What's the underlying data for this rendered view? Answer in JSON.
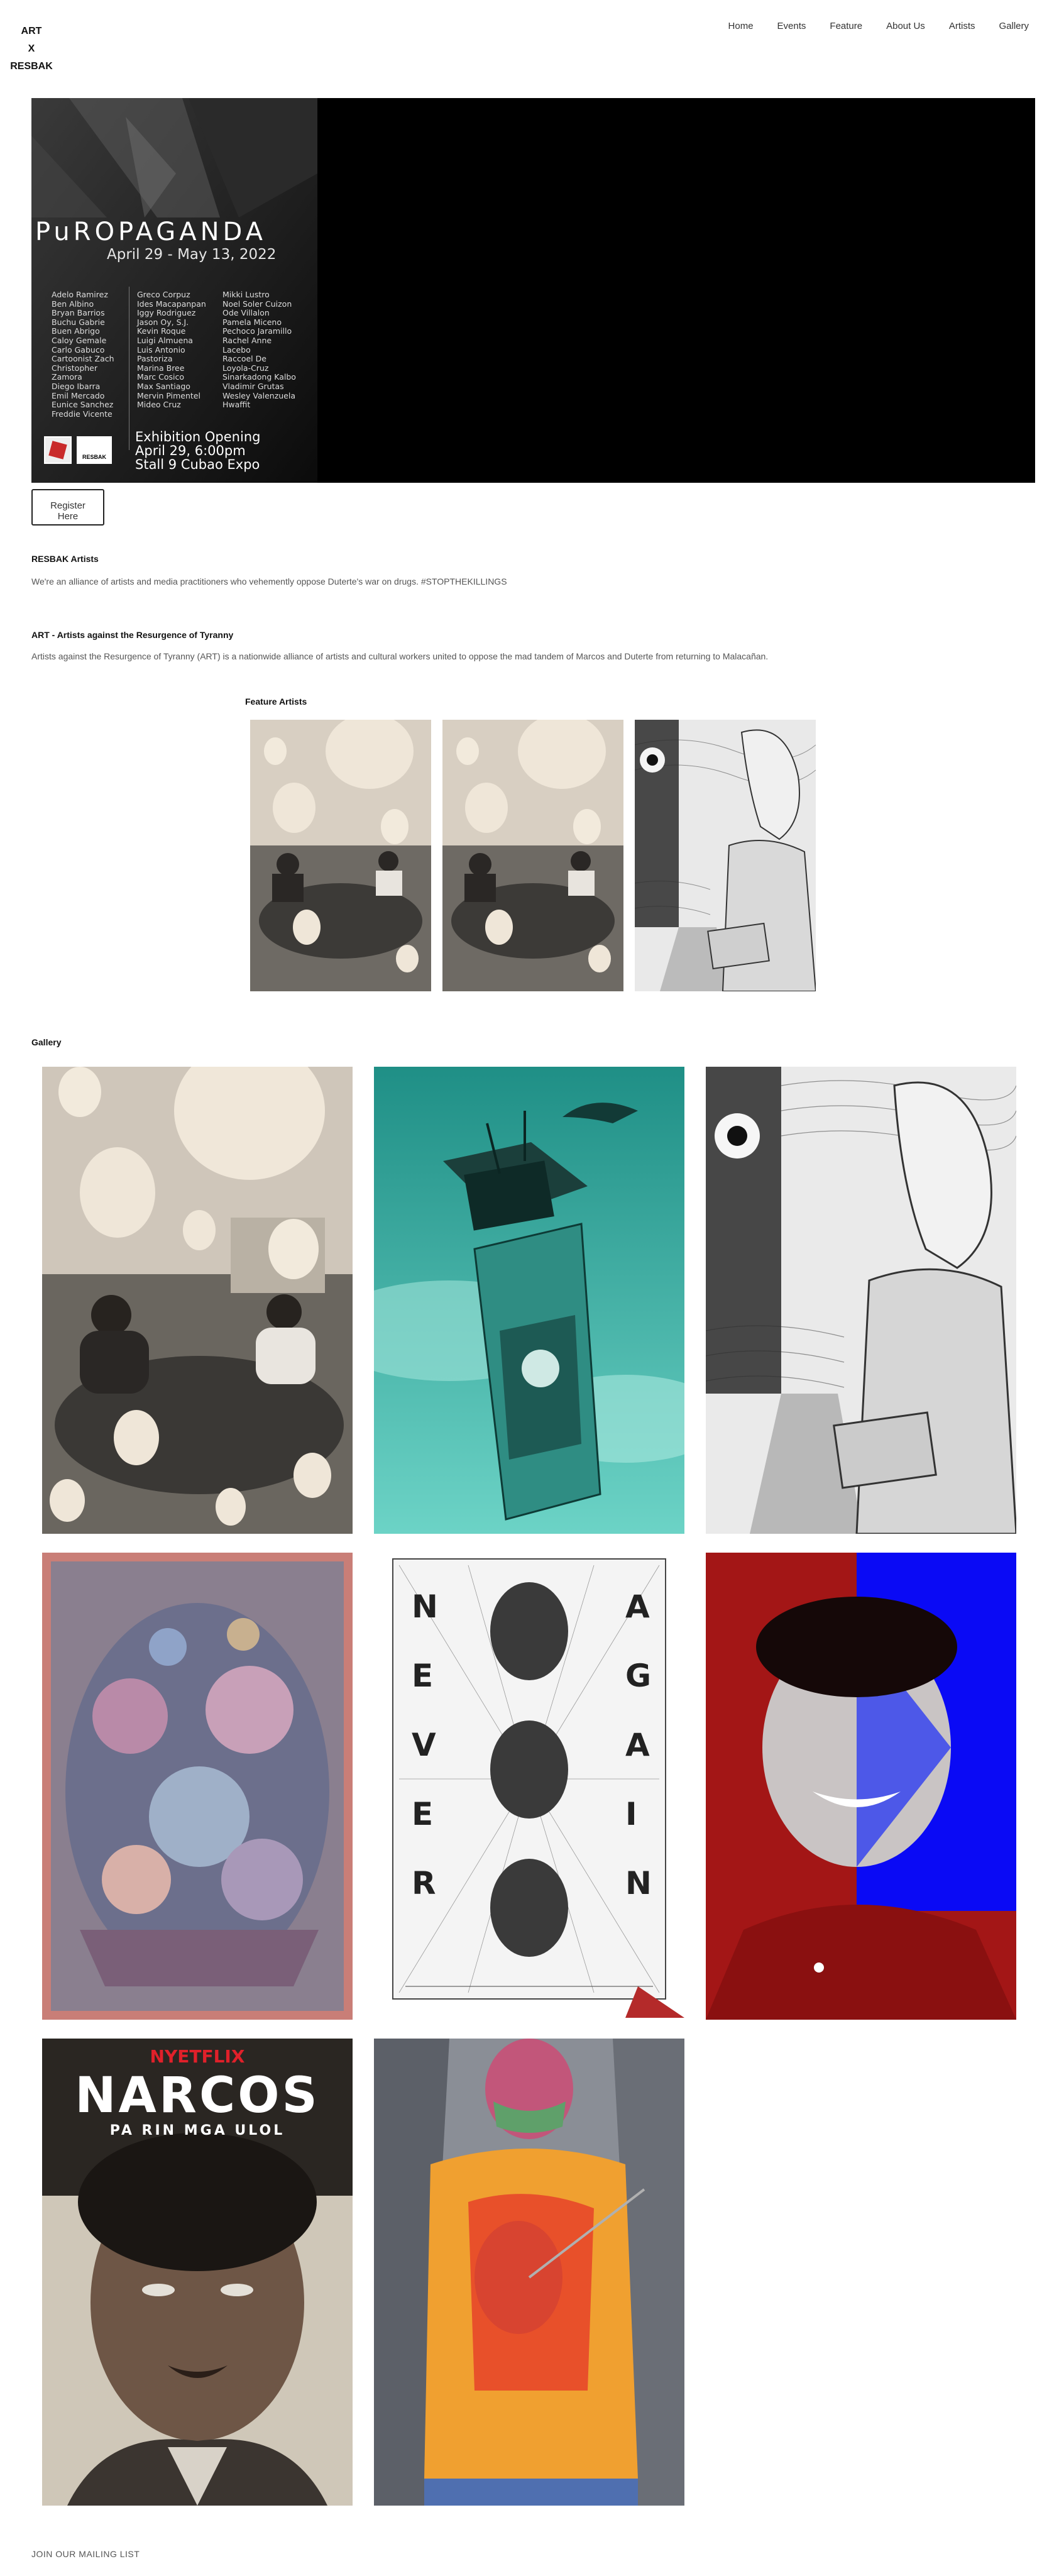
{
  "header": {
    "logo_lines": [
      "ART",
      "X",
      "RESBAK"
    ],
    "nav": [
      "Home",
      "Events",
      "Feature",
      "About Us",
      "Artists",
      "Gallery"
    ]
  },
  "hero": {
    "title": "PuROPAGANDA",
    "dates": "April 29 - May 13, 2022",
    "artists_col1": [
      "Adelo Ramirez",
      "Ben Albino",
      "Bryan Barrios",
      "Buchu Gabrie",
      "Buen Abrigo",
      "Caloy Gemale",
      "Carlo Gabuco",
      "Cartoonist Zach",
      "Christopher Zamora",
      "Diego Ibarra",
      "Emil Mercado",
      "Eunice Sanchez",
      "Freddie Vicente"
    ],
    "artists_col2": [
      "Greco Corpuz",
      "Ides Macapanpan",
      "Iggy Rodriguez",
      "Jason Oy, S.J.",
      "Kevin Roque",
      "Luigi Almuena",
      "Luis Antonio Pastoriza",
      "Marina Bree",
      "Marc Cosico",
      "Max Santiago",
      "Mervin Pimentel",
      "Mideo Cruz"
    ],
    "artists_col3": [
      "Mikki Lustro",
      "Noel Soler Cuizon",
      "Ode Villalon",
      "Pamela Miceno",
      "Pechoco Jaramillo",
      "Rachel Anne Lacebo",
      "Raccoel De Loyola-Cruz",
      "Sinarkadong Kalbo",
      "Vladimir Grutas",
      "Wesley Valenzuela",
      "Hwaffit"
    ],
    "logo_b_text": "RESBAK",
    "opening_lines": [
      "Exhibition Opening",
      "April 29, 6:00pm",
      "Stall 9 Cubao Expo"
    ]
  },
  "register_label_lines": [
    "Register",
    "Here"
  ],
  "resbak": {
    "heading": "RESBAK Artists",
    "text": "We're an alliance of artists and media practitioners who vehemently oppose Duterte's war on drugs. #STOPTHEKILLINGS"
  },
  "art": {
    "heading": "ART - Artists against the Resurgence of Tyranny",
    "text": "Artists against the Resurgence of Tyranny (ART) is a nationwide alliance of artists and cultural workers united to oppose the mad tandem of Marcos and Duterte from returning to Malacañan."
  },
  "feature": {
    "heading": "Feature Artists"
  },
  "gallery": {
    "heading": "Gallery",
    "never_again_left": [
      "N",
      "E",
      "V",
      "E",
      "R"
    ],
    "never_again_right": [
      "A",
      "G",
      "A",
      "I",
      "N"
    ],
    "narcos_brand": "NYETFLIX",
    "narcos_title": "NARCOS",
    "narcos_sub": "PA RIN MGA ULOL"
  },
  "footer": {
    "mailing": "JOIN OUR MAILING LIST"
  },
  "colors": {
    "hero_bg": "#000000",
    "teal": "#2aa79b",
    "red": "#a31616",
    "blue": "#0a0af5"
  }
}
